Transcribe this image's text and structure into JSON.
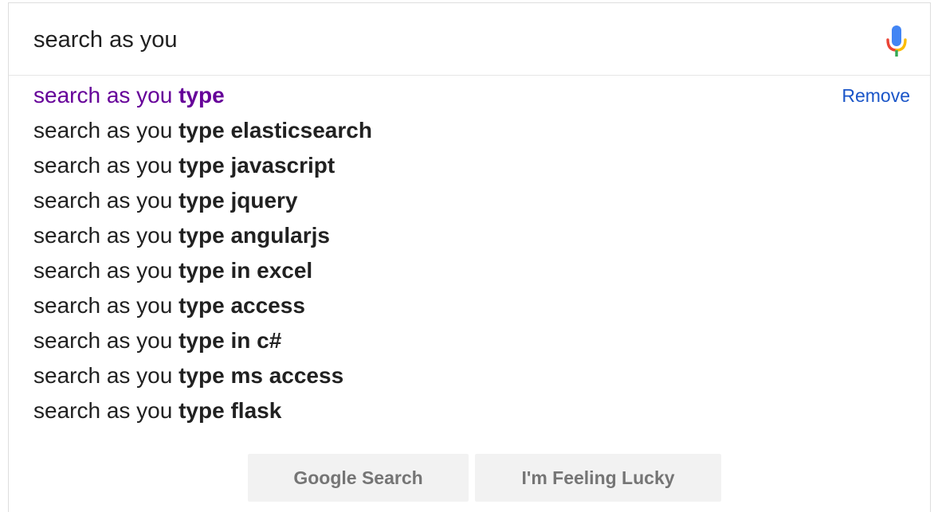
{
  "search": {
    "value": "search as you",
    "mic_icon": "microphone-icon"
  },
  "suggestions": [
    {
      "prefix": "search as you ",
      "completion": "type",
      "visited": true,
      "action": "Remove"
    },
    {
      "prefix": "search as you ",
      "completion": "type elasticsearch"
    },
    {
      "prefix": "search as you ",
      "completion": "type javascript"
    },
    {
      "prefix": "search as you ",
      "completion": "type jquery"
    },
    {
      "prefix": "search as you ",
      "completion": "type angularjs"
    },
    {
      "prefix": "search as you ",
      "completion": "type in excel"
    },
    {
      "prefix": "search as you ",
      "completion": "type access"
    },
    {
      "prefix": "search as you ",
      "completion": "type in c#"
    },
    {
      "prefix": "search as you ",
      "completion": "type ms access"
    },
    {
      "prefix": "search as you ",
      "completion": "type flask"
    }
  ],
  "buttons": {
    "search_label": "Google Search",
    "lucky_label": "I'm Feeling Lucky"
  },
  "colors": {
    "visited": "#660099",
    "link": "#1a55c8",
    "text": "#212121",
    "button_bg": "#f2f2f2",
    "mic_blue": "#4285f4",
    "mic_red": "#ea4335",
    "mic_yellow": "#fbbc05",
    "mic_green": "#34a853"
  }
}
